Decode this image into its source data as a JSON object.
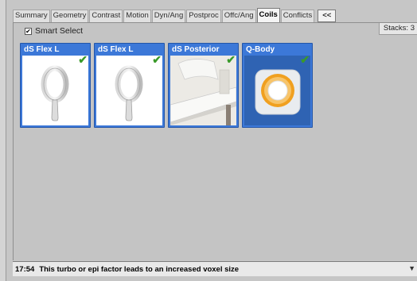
{
  "tabs": [
    {
      "label": "Summary",
      "active": false
    },
    {
      "label": "Geometry",
      "active": false
    },
    {
      "label": "Contrast",
      "active": false
    },
    {
      "label": "Motion",
      "active": false
    },
    {
      "label": "Dyn/Ang",
      "active": false
    },
    {
      "label": "Postproc",
      "active": false
    },
    {
      "label": "Offc/Ang",
      "active": false
    },
    {
      "label": "Coils",
      "active": true
    },
    {
      "label": "Conflicts",
      "active": false
    }
  ],
  "collapse_label": "<<",
  "smart_select": {
    "label": "Smart Select",
    "checked": true,
    "check_glyph": "✔"
  },
  "stacks_label": "Stacks: 3",
  "coils": [
    {
      "title": "dS Flex L",
      "selected": true,
      "image": "flex-coil-icon"
    },
    {
      "title": "dS Flex L",
      "selected": true,
      "image": "flex-coil-icon"
    },
    {
      "title": "dS Posterior",
      "selected": true,
      "image": "posterior-table-icon"
    },
    {
      "title": "Q-Body",
      "selected": true,
      "image": "scanner-bore-icon"
    }
  ],
  "check_glyph": "✔",
  "status": {
    "time": "17:54",
    "message": "This turbo or epi factor leads to an increased voxel size",
    "arrow_glyph": "▼"
  },
  "colors": {
    "coil_frame": "#3c78d8",
    "check": "#3a9a2a",
    "bore_orange": "#f0a020"
  }
}
